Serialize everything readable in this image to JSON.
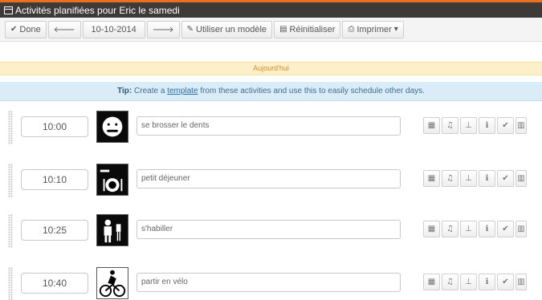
{
  "window": {
    "title": "Activités planifiées pour Eric le samedi"
  },
  "toolbar": {
    "done_label": "Done",
    "prev_icon": "arrow-left-icon",
    "date_value": "10-10-2014",
    "next_icon": "arrow-right-icon",
    "template_label": "Utiliser un modèle",
    "reset_label": "Réinitialiser",
    "print_label": "Imprimer"
  },
  "today_banner": "Aujourd'hui",
  "tip": {
    "bold": "Tip:",
    "before": "Create a",
    "link": "template",
    "after": "from these activities and use this to easily schedule other days."
  },
  "activities": [
    {
      "time": "10:00",
      "label": "se brosser le dents",
      "picto": "brushing-teeth-icon"
    },
    {
      "time": "10:10",
      "label": "petit déjeuner",
      "picto": "breakfast-icon"
    },
    {
      "time": "10:25",
      "label": "s'habiller",
      "picto": "dressing-icon"
    },
    {
      "time": "10:40",
      "label": "partir en vélo",
      "picto": "bicycle-icon"
    }
  ],
  "row_actions": [
    "calendar-icon",
    "bell-icon",
    "sitemap-icon",
    "info-icon",
    "check-icon",
    "trash-icon"
  ],
  "colors": {
    "accent": "#e9701f",
    "titlebar": "#3d3a37",
    "today_bg": "#fdf0c8",
    "tip_bg": "#d9ecf7"
  }
}
